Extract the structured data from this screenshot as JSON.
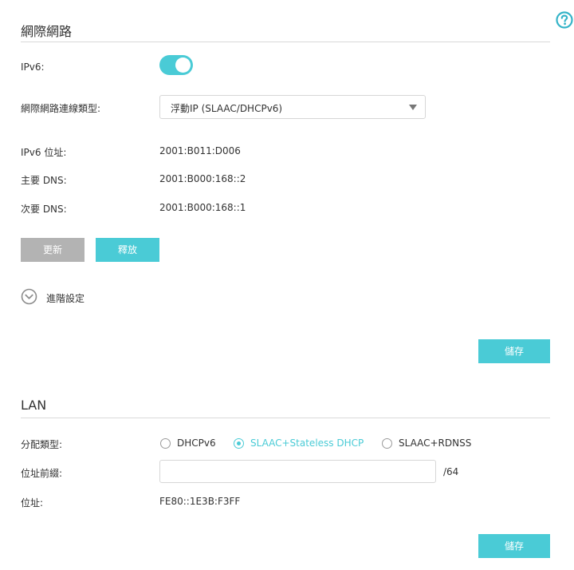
{
  "wan": {
    "title": "網際網路",
    "ipv6_label": "IPv6:",
    "ipv6_enabled": true,
    "conn_type_label": "網際網路連線類型:",
    "conn_type_value": "浮動IP (SLAAC/DHCPv6)",
    "addr_label": "IPv6 位址:",
    "addr_value": "2001:B011:D006",
    "dns1_label": "主要 DNS:",
    "dns1_value": "2001:B000:168::2",
    "dns2_label": "次要 DNS:",
    "dns2_value": "2001:B000:168::1",
    "renew_label": "更新",
    "release_label": "釋放",
    "advanced_label": "進階設定",
    "save_label": "儲存"
  },
  "lan": {
    "title": "LAN",
    "assign_label": "分配類型:",
    "options": [
      "DHCPv6",
      "SLAAC+Stateless DHCP",
      "SLAAC+RDNSS"
    ],
    "selected_option": "SLAAC+Stateless DHCP",
    "prefix_label": "位址前綴:",
    "prefix_value": "",
    "prefix_suffix": "/64",
    "addr_label": "位址:",
    "addr_value": "FE80::1E3B:F3FF",
    "save_label": "儲存"
  },
  "colors": {
    "accent": "#4acbd6",
    "disabled_button": "#b3b3b3",
    "help_icon": "#35b4c8"
  },
  "icons": {
    "help": "question-circle-icon",
    "advanced": "chevron-down-circle-icon",
    "dropdown": "caret-down-icon"
  }
}
